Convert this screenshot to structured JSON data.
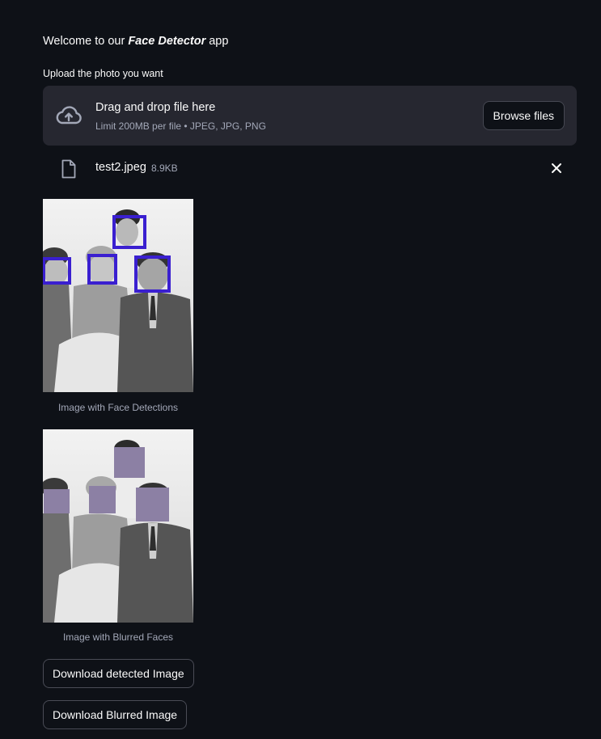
{
  "welcome": {
    "prefix": "Welcome to our ",
    "app_name": "Face Detector",
    "suffix": " app"
  },
  "uploader": {
    "label": "Upload the photo you want",
    "drop_title": "Drag and drop file here",
    "drop_subtitle": "Limit 200MB per file • JPEG, JPG, PNG",
    "browse_label": "Browse files",
    "icon": "cloud-upload-icon"
  },
  "uploaded_file": {
    "name": "test2.jpeg",
    "size": "8.9KB",
    "icon": "file-icon",
    "remove_icon": "close-icon"
  },
  "results": {
    "detected": {
      "caption": "Image with Face Detections",
      "box_color": "#3a1fd0"
    },
    "blurred": {
      "caption": "Image with Blurred Faces",
      "blur_color": "#8c80a4"
    }
  },
  "actions": {
    "download_detected": "Download detected Image",
    "download_blurred": "Download Blurred Image"
  },
  "theme": {
    "background": "#0e1117",
    "dropzone": "#262730",
    "text": "#fafafa",
    "muted": "#a3a8b8"
  }
}
